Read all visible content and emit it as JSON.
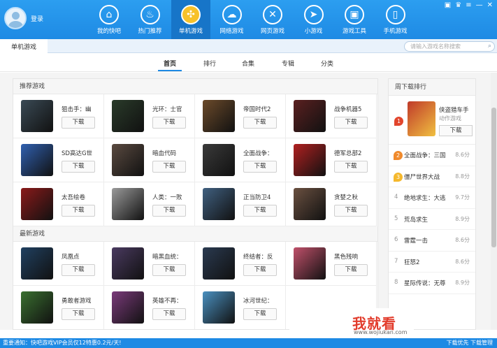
{
  "header": {
    "login_label": "登录",
    "nav": [
      {
        "label": "我的快吧",
        "icon": "home-icon",
        "glyph": "⌂"
      },
      {
        "label": "热门推荐",
        "icon": "fire-icon",
        "glyph": "♨"
      },
      {
        "label": "单机游戏",
        "icon": "gamepad-icon",
        "glyph": "✣"
      },
      {
        "label": "网络游戏",
        "icon": "cloud-icon",
        "glyph": "☁"
      },
      {
        "label": "网页游戏",
        "icon": "crossed-swords-icon",
        "glyph": "✕"
      },
      {
        "label": "小游戏",
        "icon": "paper-plane-icon",
        "glyph": "➤"
      },
      {
        "label": "游戏工具",
        "icon": "toolbox-icon",
        "glyph": "▣"
      },
      {
        "label": "手机游戏",
        "icon": "phone-icon",
        "glyph": "▯"
      }
    ],
    "active_nav": 2,
    "window_controls": [
      "▣",
      "♛",
      "≡",
      "—",
      "✕"
    ]
  },
  "subbar": {
    "tab_label": "单机游戏",
    "search_placeholder": "请输入游戏名称搜索",
    "search_icon": "search-icon"
  },
  "tabs": [
    "首页",
    "排行",
    "合集",
    "专辑",
    "分类"
  ],
  "active_tab": 0,
  "recommended": {
    "title": "推荐游戏",
    "games": [
      {
        "name": "狙击手：幽",
        "color": "#3a4a55"
      },
      {
        "name": "光环：士官",
        "color": "#2a3b2a"
      },
      {
        "name": "帝国时代2",
        "color": "#6b4a2a"
      },
      {
        "name": "战争机器5",
        "color": "#5a2020"
      },
      {
        "name": "SD高达G世",
        "color": "#3060b0"
      },
      {
        "name": "暗血代码",
        "color": "#5a4a40"
      },
      {
        "name": "全面战争：",
        "color": "#3a3a3a"
      },
      {
        "name": "德军总部2",
        "color": "#b02020"
      },
      {
        "name": "太吾绘卷",
        "color": "#8a1a1a"
      },
      {
        "name": "人类：一败",
        "color": "#9a9a9a"
      },
      {
        "name": "正当防卫4",
        "color": "#406080"
      },
      {
        "name": "贪婪之秋",
        "color": "#6a5040"
      }
    ]
  },
  "latest": {
    "title": "最新游戏",
    "games": [
      {
        "name": "凤凰点",
        "color": "#204060"
      },
      {
        "name": "暗黑血统：",
        "color": "#4a3a60"
      },
      {
        "name": "终结者：反",
        "color": "#2a3a50"
      },
      {
        "name": "黑色残响",
        "color": "#c0506a"
      },
      {
        "name": "勇敢者游戏",
        "color": "#3a7030"
      },
      {
        "name": "英雄不再：",
        "color": "#7a3a7a"
      },
      {
        "name": "冰河世纪：",
        "color": "#4a90c0"
      },
      {
        "name": "",
        "color": "#ffffff"
      }
    ]
  },
  "download_label": "下载",
  "ranking": {
    "title": "周下载排行",
    "top": {
      "num": "1",
      "name": "侠盗猎车手",
      "sub": "动作游戏",
      "color": "#c03a2a"
    },
    "items": [
      {
        "num": "2",
        "name": "全面战争：三国",
        "score": "8.6分"
      },
      {
        "num": "3",
        "name": "僵尸世界大战",
        "score": "8.8分"
      },
      {
        "num": "4",
        "name": "绝地求生：大逃",
        "score": "9.7分"
      },
      {
        "num": "5",
        "name": "荒岛求生",
        "score": "8.9分"
      },
      {
        "num": "6",
        "name": "雷霆一击",
        "score": "8.6分"
      },
      {
        "num": "7",
        "name": "狂怒2",
        "score": "8.6分"
      },
      {
        "num": "8",
        "name": "星际传说：无尊",
        "score": "8.9分"
      }
    ]
  },
  "status": {
    "notice": "重要通知：快吧游戏VIP会员仅12特惠0.2元/天!",
    "right": "下载优先  下载管理"
  },
  "watermark": {
    "main": "我就看",
    "url": "www.wojiukan.com"
  }
}
